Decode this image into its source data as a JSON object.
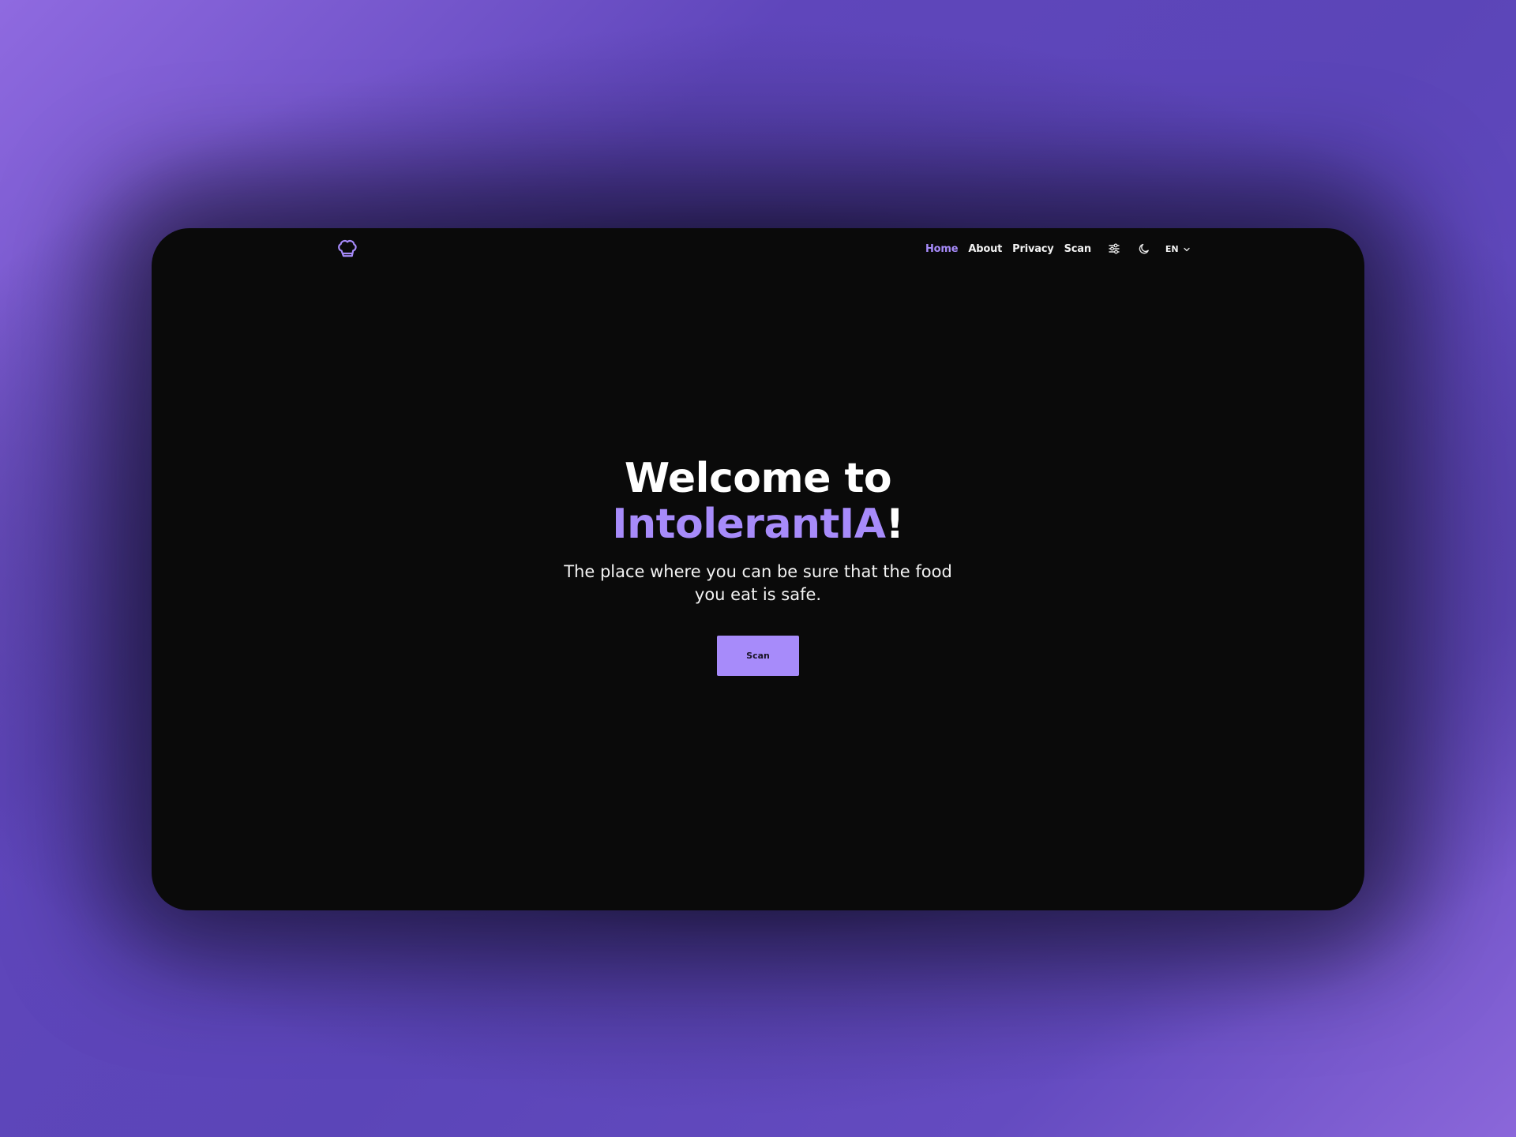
{
  "nav": {
    "items": [
      {
        "label": "Home",
        "active": true
      },
      {
        "label": "About",
        "active": false
      },
      {
        "label": "Privacy",
        "active": false
      },
      {
        "label": "Scan",
        "active": false
      }
    ],
    "icons": {
      "logo": "chef-hat-icon",
      "filters": "sliders-icon",
      "theme": "moon-icon",
      "language_caret": "chevron-down-icon"
    },
    "language": "EN"
  },
  "hero": {
    "title_line1": "Welcome to",
    "brand": "IntolerantIA",
    "exclamation": "!",
    "subtitle": "The place where you can be sure that the food you eat is safe.",
    "cta_label": "Scan"
  },
  "colors": {
    "accent": "#a78bfa",
    "background": "#0a0a0a",
    "text": "#ffffff"
  }
}
